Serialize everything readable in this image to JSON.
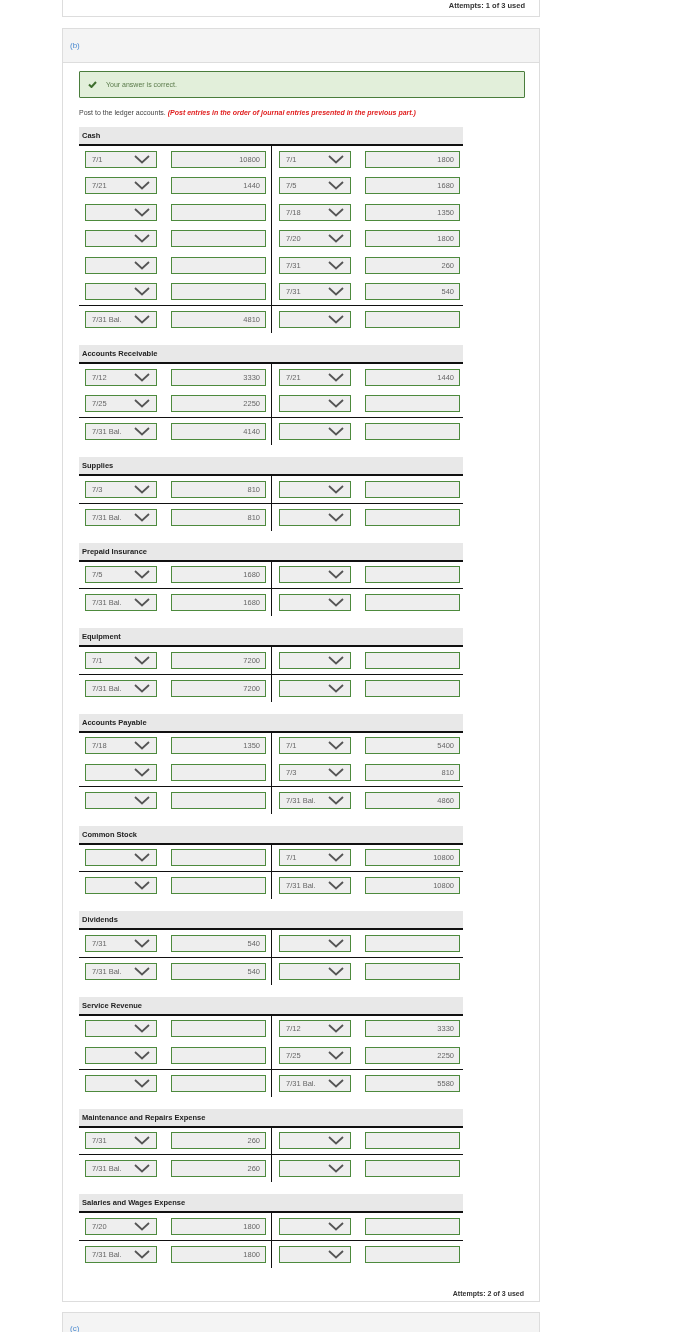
{
  "previous_part": {
    "attempts": "Attempts: 1 of 3 used"
  },
  "part": {
    "label": "(b)",
    "feedback": "Your answer is correct.",
    "instruction": "Post to the ledger accounts.",
    "instruction_note": "(Post entries in the order of journal entries presented in the previous part.)",
    "accounts": [
      {
        "name": "Cash",
        "rows": [
          {
            "debit_date": "7/1",
            "debit_amount": "10800",
            "credit_date": "7/1",
            "credit_amount": "1800"
          },
          {
            "debit_date": "7/21",
            "debit_amount": "1440",
            "credit_date": "7/5",
            "credit_amount": "1680"
          },
          {
            "credit_date": "7/18",
            "credit_amount": "1350"
          },
          {
            "credit_date": "7/20",
            "credit_amount": "1800"
          },
          {
            "credit_date": "7/31",
            "credit_amount": "260"
          },
          {
            "credit_date": "7/31",
            "credit_amount": "540"
          }
        ],
        "balance": {
          "debit_date": "7/31 Bal.",
          "debit_amount": "4810"
        }
      },
      {
        "name": "Accounts Receivable",
        "rows": [
          {
            "debit_date": "7/12",
            "debit_amount": "3330",
            "credit_date": "7/21",
            "credit_amount": "1440"
          },
          {
            "debit_date": "7/25",
            "debit_amount": "2250"
          }
        ],
        "balance": {
          "debit_date": "7/31 Bal.",
          "debit_amount": "4140"
        }
      },
      {
        "name": "Supplies",
        "rows": [
          {
            "debit_date": "7/3",
            "debit_amount": "810"
          }
        ],
        "balance": {
          "debit_date": "7/31 Bal.",
          "debit_amount": "810"
        }
      },
      {
        "name": "Prepaid Insurance",
        "rows": [
          {
            "debit_date": "7/5",
            "debit_amount": "1680"
          }
        ],
        "balance": {
          "debit_date": "7/31 Bal.",
          "debit_amount": "1680"
        }
      },
      {
        "name": "Equipment",
        "rows": [
          {
            "debit_date": "7/1",
            "debit_amount": "7200"
          }
        ],
        "balance": {
          "debit_date": "7/31 Bal.",
          "debit_amount": "7200"
        }
      },
      {
        "name": "Accounts Payable",
        "rows": [
          {
            "debit_date": "7/18",
            "debit_amount": "1350",
            "credit_date": "7/1",
            "credit_amount": "5400"
          },
          {
            "credit_date": "7/3",
            "credit_amount": "810"
          }
        ],
        "balance": {
          "credit_date": "7/31 Bal.",
          "credit_amount": "4860"
        }
      },
      {
        "name": "Common Stock",
        "rows": [
          {
            "credit_date": "7/1",
            "credit_amount": "10800"
          }
        ],
        "balance": {
          "credit_date": "7/31 Bal.",
          "credit_amount": "10800"
        }
      },
      {
        "name": "Dividends",
        "rows": [
          {
            "debit_date": "7/31",
            "debit_amount": "540"
          }
        ],
        "balance": {
          "debit_date": "7/31 Bal.",
          "debit_amount": "540"
        }
      },
      {
        "name": "Service Revenue",
        "rows": [
          {
            "credit_date": "7/12",
            "credit_amount": "3330"
          },
          {
            "credit_date": "7/25",
            "credit_amount": "2250"
          }
        ],
        "balance": {
          "credit_date": "7/31 Bal.",
          "credit_amount": "5580"
        }
      },
      {
        "name": "Maintenance and Repairs Expense",
        "rows": [
          {
            "debit_date": "7/31",
            "debit_amount": "260"
          }
        ],
        "balance": {
          "debit_date": "7/31 Bal.",
          "debit_amount": "260"
        }
      },
      {
        "name": "Salaries and Wages Expense",
        "rows": [
          {
            "debit_date": "7/20",
            "debit_amount": "1800"
          }
        ],
        "balance": {
          "debit_date": "7/31 Bal.",
          "debit_amount": "1800"
        }
      }
    ],
    "attempts": "Attempts: 2 of 3 used"
  },
  "next_part": {
    "label": "(c)"
  }
}
